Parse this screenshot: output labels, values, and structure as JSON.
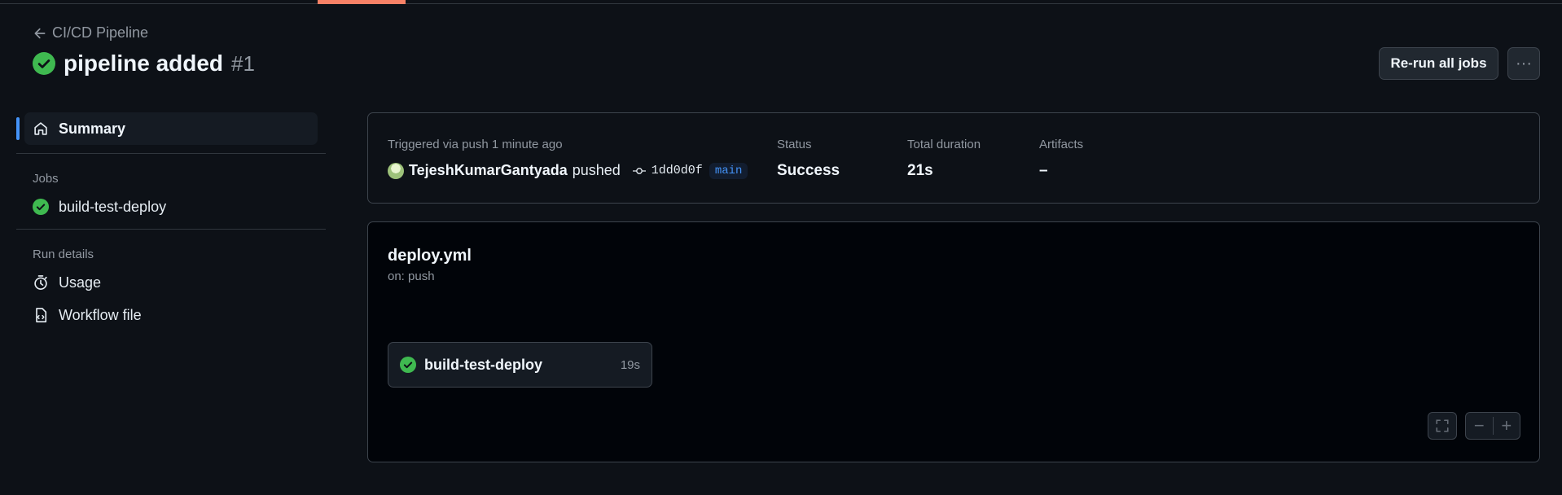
{
  "header": {
    "back_label": "CI/CD Pipeline",
    "run_title": "pipeline added",
    "run_number": "#1",
    "rerun_label": "Re-run all jobs",
    "more_label": "···"
  },
  "sidebar": {
    "summary_label": "Summary",
    "jobs_heading": "Jobs",
    "jobs": [
      {
        "label": "build-test-deploy",
        "status": "success"
      }
    ],
    "run_details_heading": "Run details",
    "usage_label": "Usage",
    "workflow_file_label": "Workflow file"
  },
  "summary": {
    "triggered_label": "Triggered via push 1 minute ago",
    "user": "TejeshKumarGantyada",
    "action": "pushed",
    "commit": "1dd0d0f",
    "branch": "main",
    "status_label": "Status",
    "status_value": "Success",
    "duration_label": "Total duration",
    "duration_value": "21s",
    "artifacts_label": "Artifacts",
    "artifacts_value": "–"
  },
  "workflow": {
    "file": "deploy.yml",
    "trigger": "on: push",
    "job_name": "build-test-deploy",
    "job_duration": "19s",
    "zoom_out": "−",
    "zoom_in": "+"
  },
  "colors": {
    "success": "#3fb950",
    "accent": "#4493f8",
    "tab_underline": "#f78166"
  }
}
